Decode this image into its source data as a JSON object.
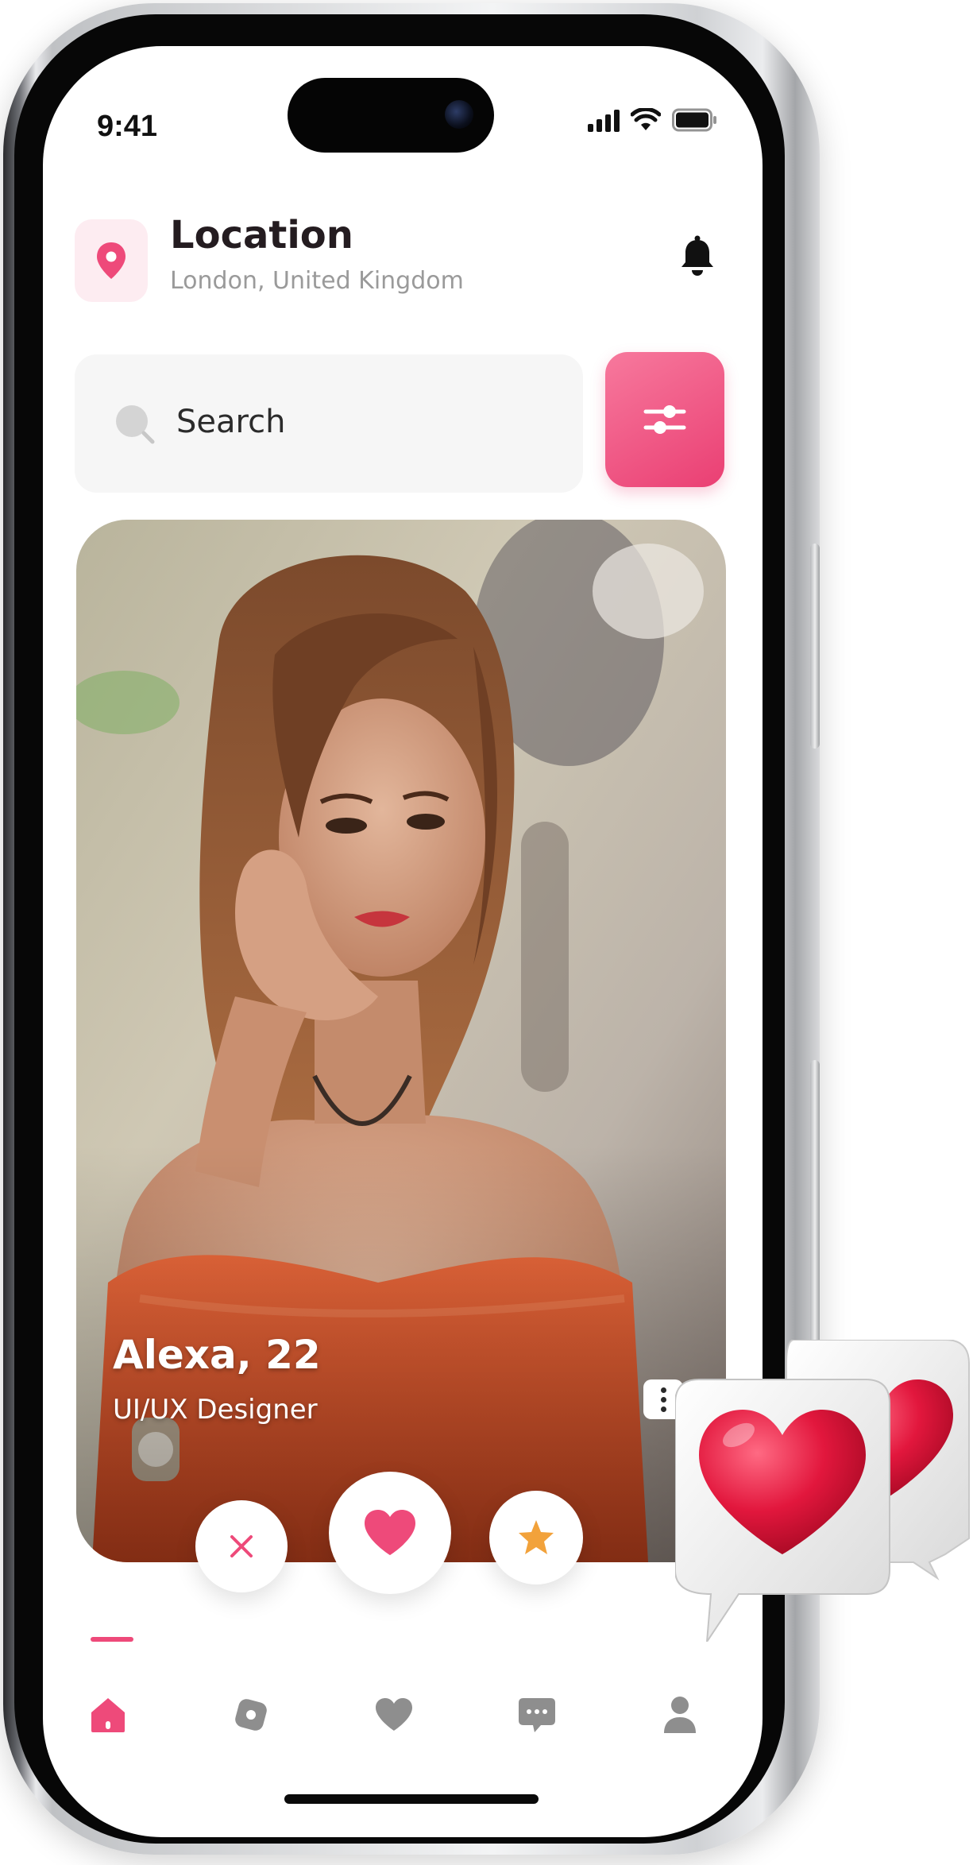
{
  "status_bar": {
    "time": "9:41"
  },
  "header": {
    "title": "Location",
    "location": "London, United Kingdom"
  },
  "search": {
    "placeholder": "Search"
  },
  "profile": {
    "name_age": "Alexa, 22",
    "role": "UI/UX Designer"
  },
  "actions": [
    "dislike",
    "like",
    "super-like"
  ],
  "bottom_nav": {
    "items": [
      "home",
      "discover",
      "likes",
      "messages",
      "profile"
    ],
    "active": "home"
  },
  "colors": {
    "accent": "#ee4a7a",
    "accent_light": "#fdecf1",
    "star": "#f2a23b",
    "inactive_icon": "#8e8e8e",
    "text_dark": "#241c20",
    "text_muted": "#9a9a9a"
  },
  "icons": {
    "location": "map-pin-icon",
    "notification": "bell-icon",
    "search": "search-icon",
    "filter": "sliders-icon",
    "more": "vertical-dots-icon",
    "dislike": "close-icon",
    "like": "heart-icon",
    "super_like": "star-icon"
  }
}
